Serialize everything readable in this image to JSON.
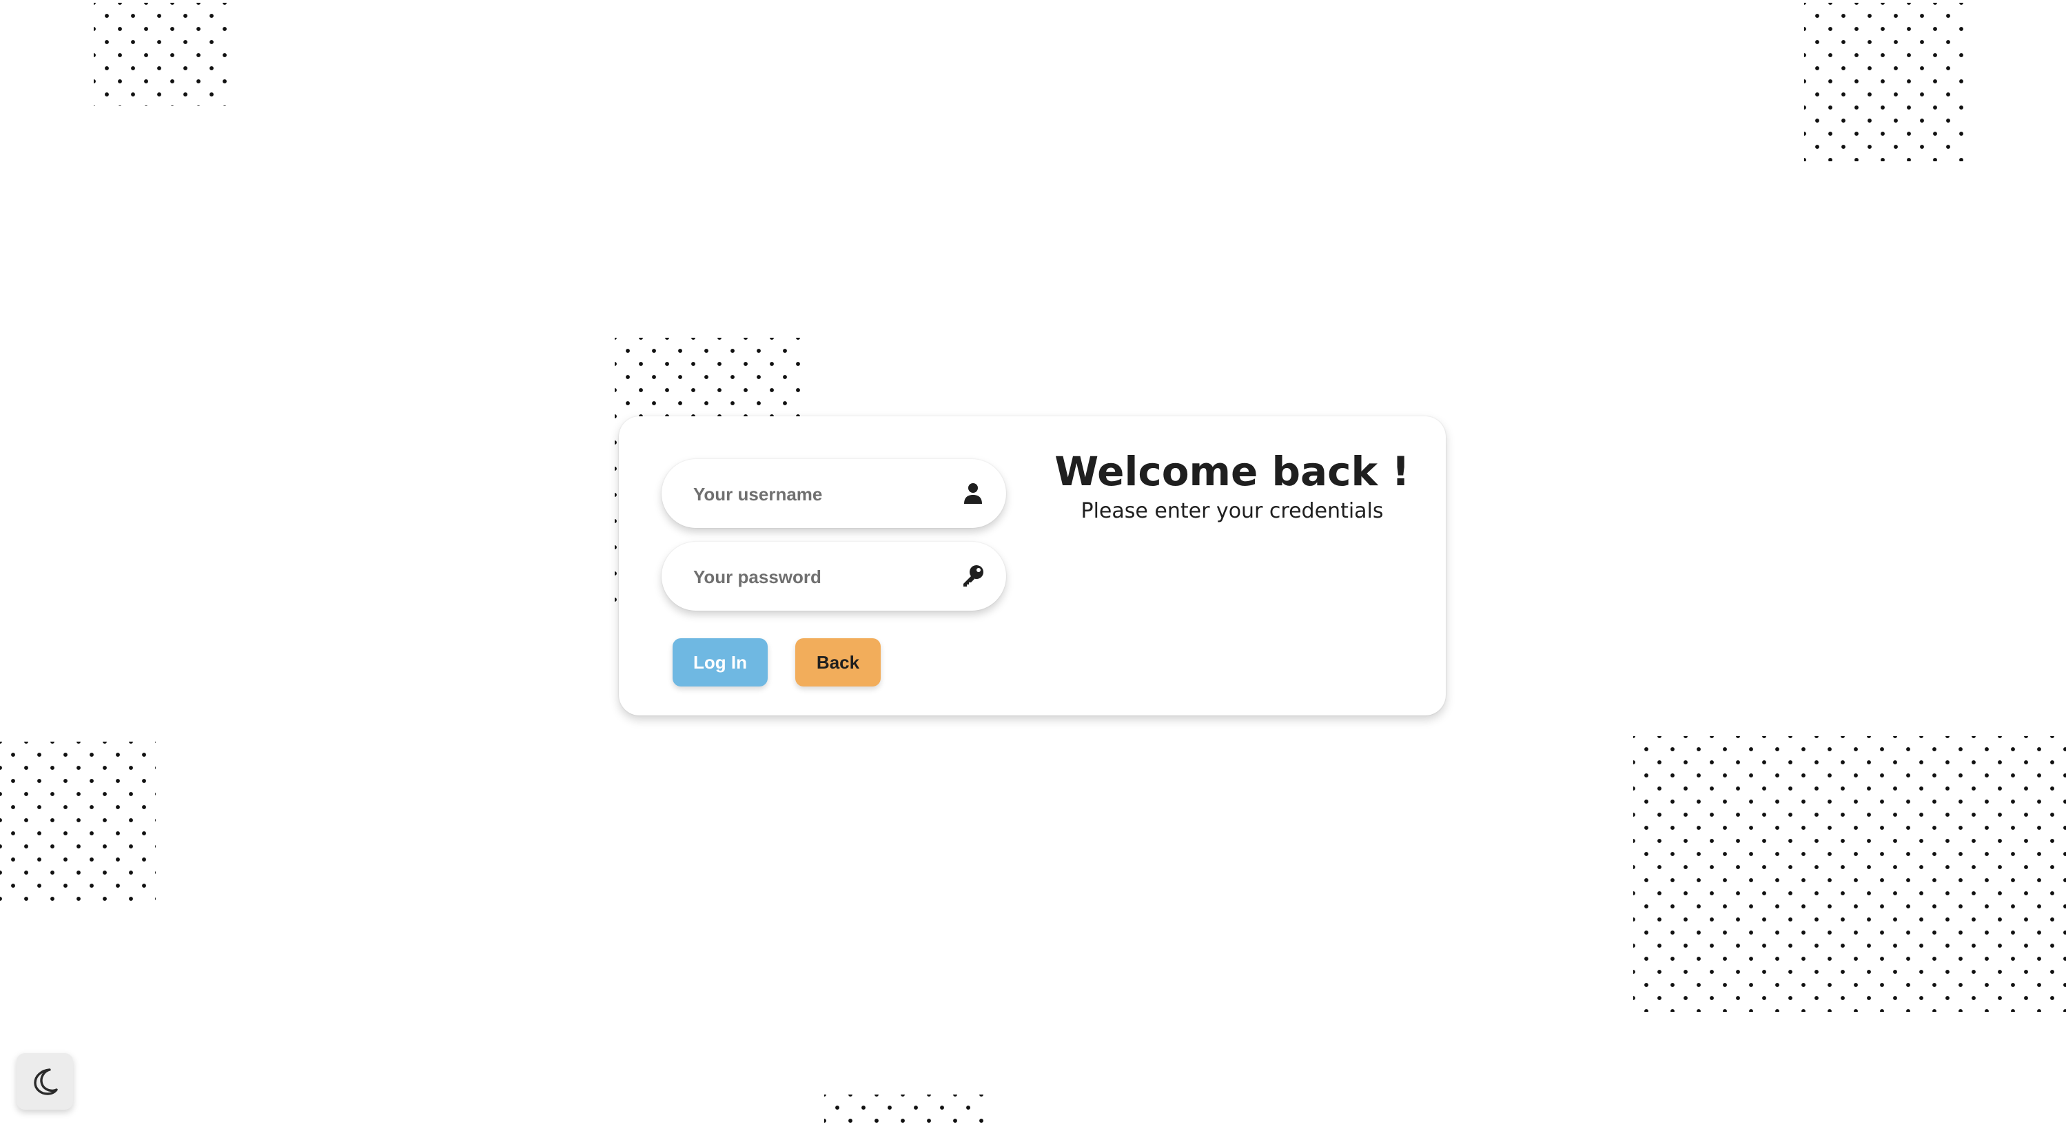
{
  "login_form": {
    "username": {
      "placeholder": "Your username",
      "value": "",
      "icon": "user-icon"
    },
    "password": {
      "placeholder": "Your password",
      "value": "",
      "icon": "key-icon"
    },
    "login_label": "Log In",
    "back_label": "Back"
  },
  "welcome": {
    "title": "Welcome back !",
    "subtitle": "Please enter your credentials"
  },
  "theme_toggle": {
    "icon": "moon-icon"
  },
  "colors": {
    "login_button": "#6fb8e2",
    "back_button": "#f2ad5b",
    "background": "#ffffff",
    "text": "#1f1f1f"
  }
}
